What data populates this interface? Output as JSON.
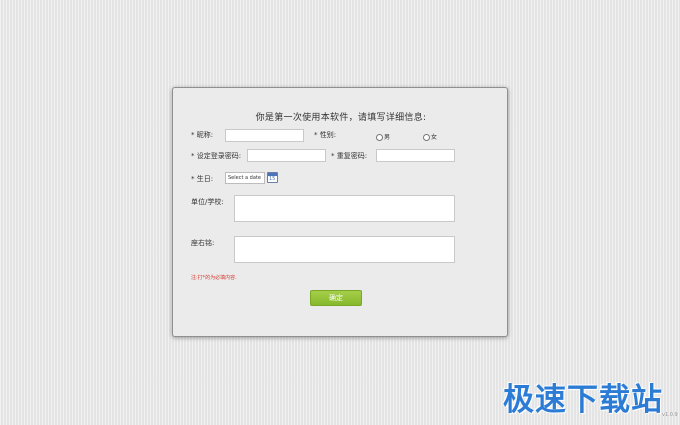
{
  "form": {
    "title": "你是第一次使用本软件，请填写详细信息:",
    "nickname_label": "* 昵称:",
    "gender_label": "* 性别:",
    "gender_male": "男",
    "gender_female": "女",
    "login_password_label": "* 设定登录密码:",
    "repeat_password_label": "* 重复密码:",
    "birthday_label": "* 生日:",
    "birthday_placeholder": "Select a date",
    "calendar_icon_text": "15",
    "organization_label": "单位/学校:",
    "motto_label": "座右铭:",
    "required_note": "注:打*的为必填内容.",
    "confirm_button": "确定"
  },
  "watermark": "极速下载站",
  "version": "v1.0.9",
  "colors": {
    "accent_button": "#8fc236",
    "required_note": "#d23b2f",
    "watermark": "#2c7cd6"
  }
}
